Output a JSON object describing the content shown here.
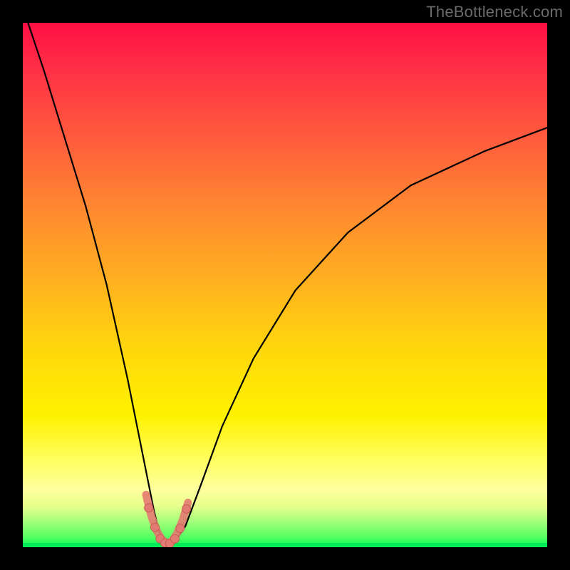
{
  "watermark": "TheBottleneck.com",
  "colors": {
    "frame": "#000000",
    "curve_stroke": "#000000",
    "marker_fill": "#e37a71",
    "marker_stroke": "#c55b52",
    "gradient_top": "#ff0e44",
    "gradient_bottom": "#00ff55"
  },
  "chart_data": {
    "type": "line",
    "title": "",
    "xlabel": "",
    "ylabel": "",
    "xlim": [
      0,
      100
    ],
    "ylim": [
      0,
      100
    ],
    "grid": false,
    "legend": false,
    "curve_main": {
      "name": "bottleneck-curve",
      "x": [
        0,
        4,
        8,
        12,
        16,
        18,
        20,
        22,
        24,
        25,
        26,
        27,
        28,
        29,
        31,
        34,
        38,
        44,
        52,
        62,
        74,
        88,
        100
      ],
      "y": [
        103,
        91,
        78,
        65,
        50,
        41,
        32,
        22,
        12,
        7,
        3,
        1,
        0.5,
        1,
        4,
        12,
        23,
        36,
        49,
        60,
        69,
        75.5,
        80
      ]
    },
    "curve_marker_band": {
      "name": "trough-marker-band",
      "x": [
        23.5,
        24.5,
        25.5,
        26.5,
        27.5,
        28.5,
        29.5,
        30.5,
        31.5
      ],
      "y": [
        10.0,
        6.0,
        3.2,
        1.5,
        0.7,
        1.2,
        2.8,
        5.2,
        8.5
      ]
    },
    "markers": {
      "name": "trough-points",
      "points": [
        {
          "x": 24.0,
          "y": 7.5
        },
        {
          "x": 25.2,
          "y": 3.8
        },
        {
          "x": 26.2,
          "y": 1.6
        },
        {
          "x": 27.1,
          "y": 0.8
        },
        {
          "x": 28.0,
          "y": 0.7
        },
        {
          "x": 29.0,
          "y": 1.6
        },
        {
          "x": 30.0,
          "y": 3.6
        },
        {
          "x": 31.2,
          "y": 7.3
        }
      ],
      "radius_px": 6
    }
  }
}
